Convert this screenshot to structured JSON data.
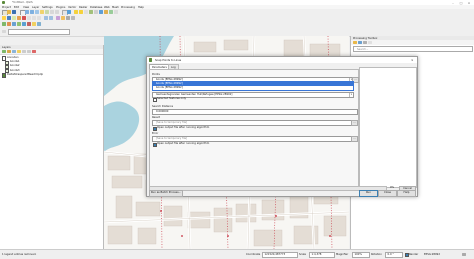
{
  "window": {
    "title": "*Untitled - QGIS"
  },
  "menu": [
    "Project",
    "Edit",
    "View",
    "Layer",
    "Settings",
    "Plugins",
    "Vector",
    "Raster",
    "Database",
    "Web",
    "Mesh",
    "Processing",
    "Help"
  ],
  "layers_panel": {
    "title": "Layers",
    "items": [
      "Annoden",
      "bonds1",
      "bonds2",
      "bonds3",
      "DeltaStraspenntBeachUpdp"
    ]
  },
  "processing_toolbox": {
    "title": "Processing Toolbox",
    "search_placeholder": "Search..."
  },
  "dialog": {
    "title": "Snap Points to Lines",
    "tabs": [
      "Parameters",
      "Log"
    ],
    "input_label": "Points",
    "input_value": "bonds [EPSG:28992]",
    "dropdown_options": [
      "bonds [EPSG:28992]",
      "bonds [EPSG:28992]"
    ],
    "lines_value": "Gemeentegrenzen Gemeenten Hull/Refugee [EPSG:28992]",
    "selected_only": "Selected features only",
    "distance_label": "Search Distance",
    "distance_value": "0.000000",
    "result_label": "Result",
    "result_placeholder": "[Save to temporary file]",
    "open_output_1": "Open output file after running algorithm",
    "error_label": "Error",
    "error_placeholder": "[Save to temporary file]",
    "open_output_2": "Open output file after running algorithm",
    "progress": "0%",
    "batch_button": "Run as Batch Process...",
    "run_button": "Run",
    "close_button": "Close",
    "help_button": "Help",
    "cancel_button": "Cancel"
  },
  "status": {
    "message": "1 legend entries removed.",
    "coordinate_label": "Coordinate",
    "coordinate": "121520,487773",
    "scale_label": "Scale",
    "scale": "1:4,378",
    "magnifier_label": "Magnifier",
    "magnifier": "100%",
    "rotation_label": "Rotation",
    "rotation": "0.0 °",
    "render": "Render",
    "crs": "EPSG:28992"
  },
  "colors": {
    "accent": "#3c7fb1",
    "selection": "#3875d6",
    "qgis_green": "#5a8a3a"
  }
}
